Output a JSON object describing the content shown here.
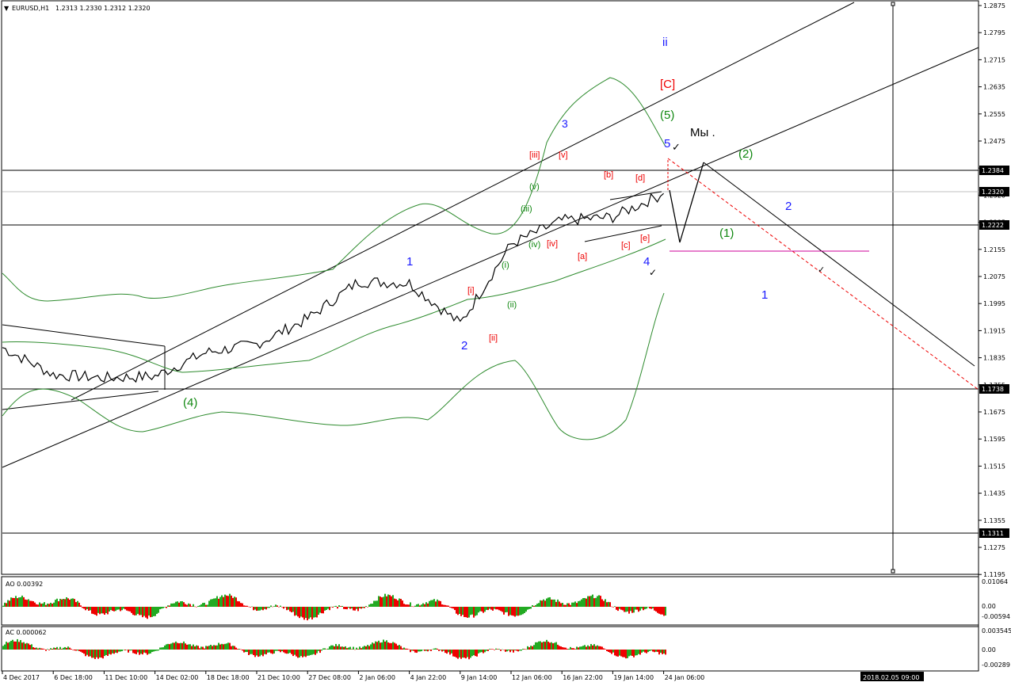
{
  "header": {
    "symbol": "EURUSD,H1",
    "ohlc": "1.2313 1.2330 1.2312 1.2320"
  },
  "colors": {
    "wave_blue": "#1a1aff",
    "wave_red": "#ee0000",
    "wave_green": "#118811",
    "ao_up": "#22aa22",
    "ao_down": "#ee0000",
    "bollinger": "#2e8b2e",
    "target_line": "#cc0099",
    "projection": "#ee0000"
  },
  "price_axis": {
    "ticks": [
      "1.2875",
      "1.2795",
      "1.2715",
      "1.2635",
      "1.2555",
      "1.2475",
      "1.2395",
      "1.2320",
      "1.2235",
      "1.2155",
      "1.2075",
      "1.1995",
      "1.1915",
      "1.1835",
      "1.1755",
      "1.1675",
      "1.1595",
      "1.1515",
      "1.1435",
      "1.1355",
      "1.1275",
      "1.1195"
    ]
  },
  "levels": [
    {
      "label": "1.2384"
    },
    {
      "label": "1.2320"
    },
    {
      "label": "1.2222"
    },
    {
      "label": "1.1738"
    },
    {
      "label": "1.1311"
    }
  ],
  "time_axis": {
    "ticks": [
      "4 Dec 2017",
      "6 Dec 18:00",
      "11 Dec 10:00",
      "14 Dec 02:00",
      "18 Dec 18:00",
      "21 Dec 10:00",
      "27 Dec 08:00",
      "2 Jan 06:00",
      "4 Jan 22:00",
      "9 Jan 14:00",
      "12 Jan 06:00",
      "16 Jan 22:00",
      "19 Jan 14:00",
      "24 Jan 06:00"
    ],
    "cursor_label": "2018.02.05 09:00"
  },
  "indicators": {
    "ao": {
      "label": "AO 0.00392",
      "ticks": [
        "0.01064",
        "0.00",
        "-0.00594"
      ]
    },
    "ac": {
      "label": "AC 0.000062",
      "ticks": [
        "0.003545",
        "0.00",
        "-0.00289"
      ]
    }
  },
  "wave_labels": [
    {
      "text": "ii",
      "color": "blue"
    },
    {
      "text": "[C]",
      "color": "red"
    },
    {
      "text": "(5)",
      "color": "green"
    },
    {
      "text": "3",
      "color": "blue"
    },
    {
      "text": "5",
      "color": "blue"
    },
    {
      "text": "Мы .",
      "color": "black"
    },
    {
      "text": "(2)",
      "color": "green"
    },
    {
      "text": "2",
      "color": "blue"
    },
    {
      "text": "(1)",
      "color": "green"
    },
    {
      "text": "1",
      "color": "blue"
    },
    {
      "text": "4",
      "color": "blue"
    },
    {
      "text": "1",
      "color": "blue"
    },
    {
      "text": "2",
      "color": "blue"
    },
    {
      "text": "(4)",
      "color": "green"
    },
    {
      "text": "[iii]",
      "color": "red"
    },
    {
      "text": "[v]",
      "color": "red"
    },
    {
      "text": "[b]",
      "color": "red"
    },
    {
      "text": "[d]",
      "color": "red"
    },
    {
      "text": "[a]",
      "color": "red"
    },
    {
      "text": "[c]",
      "color": "red"
    },
    {
      "text": "[e]",
      "color": "red"
    },
    {
      "text": "[iv]",
      "color": "red"
    },
    {
      "text": "[i]",
      "color": "red"
    },
    {
      "text": "[ii]",
      "color": "red"
    },
    {
      "text": "(v)",
      "color": "green"
    },
    {
      "text": "(iii)",
      "color": "green"
    },
    {
      "text": "(iv)",
      "color": "green"
    },
    {
      "text": "(i)",
      "color": "green"
    },
    {
      "text": "(ii)",
      "color": "green"
    }
  ],
  "chart_data": {
    "type": "line",
    "title": "EURUSD,H1",
    "ylim": [
      1.1195,
      1.2875
    ],
    "price_path": [
      [
        "4 Dec 2017",
        1.1865
      ],
      [
        "6 Dec 18:00",
        1.1785
      ],
      [
        "11 Dec 10:00",
        1.1775
      ],
      [
        "14 Dec 02:00",
        1.178
      ],
      [
        "18 Dec 18:00",
        1.185
      ],
      [
        "21 Dec 10:00",
        1.1875
      ],
      [
        "27 Dec 08:00",
        1.195
      ],
      [
        "2 Jan 06:00",
        1.206
      ],
      [
        "4 Jan 22:00",
        1.2055
      ],
      [
        "9 Jan 14:00",
        1.1935
      ],
      [
        "12 Jan 06:00",
        1.217
      ],
      [
        "16 Jan 22:00",
        1.224
      ],
      [
        "19 Jan 14:00",
        1.225
      ],
      [
        "24 Jan 06:00",
        1.232
      ]
    ],
    "horizontal_levels": [
      1.2384,
      1.232,
      1.2222,
      1.1738,
      1.1311
    ],
    "ao_last": 0.00392,
    "ac_last": 6.2e-05
  }
}
